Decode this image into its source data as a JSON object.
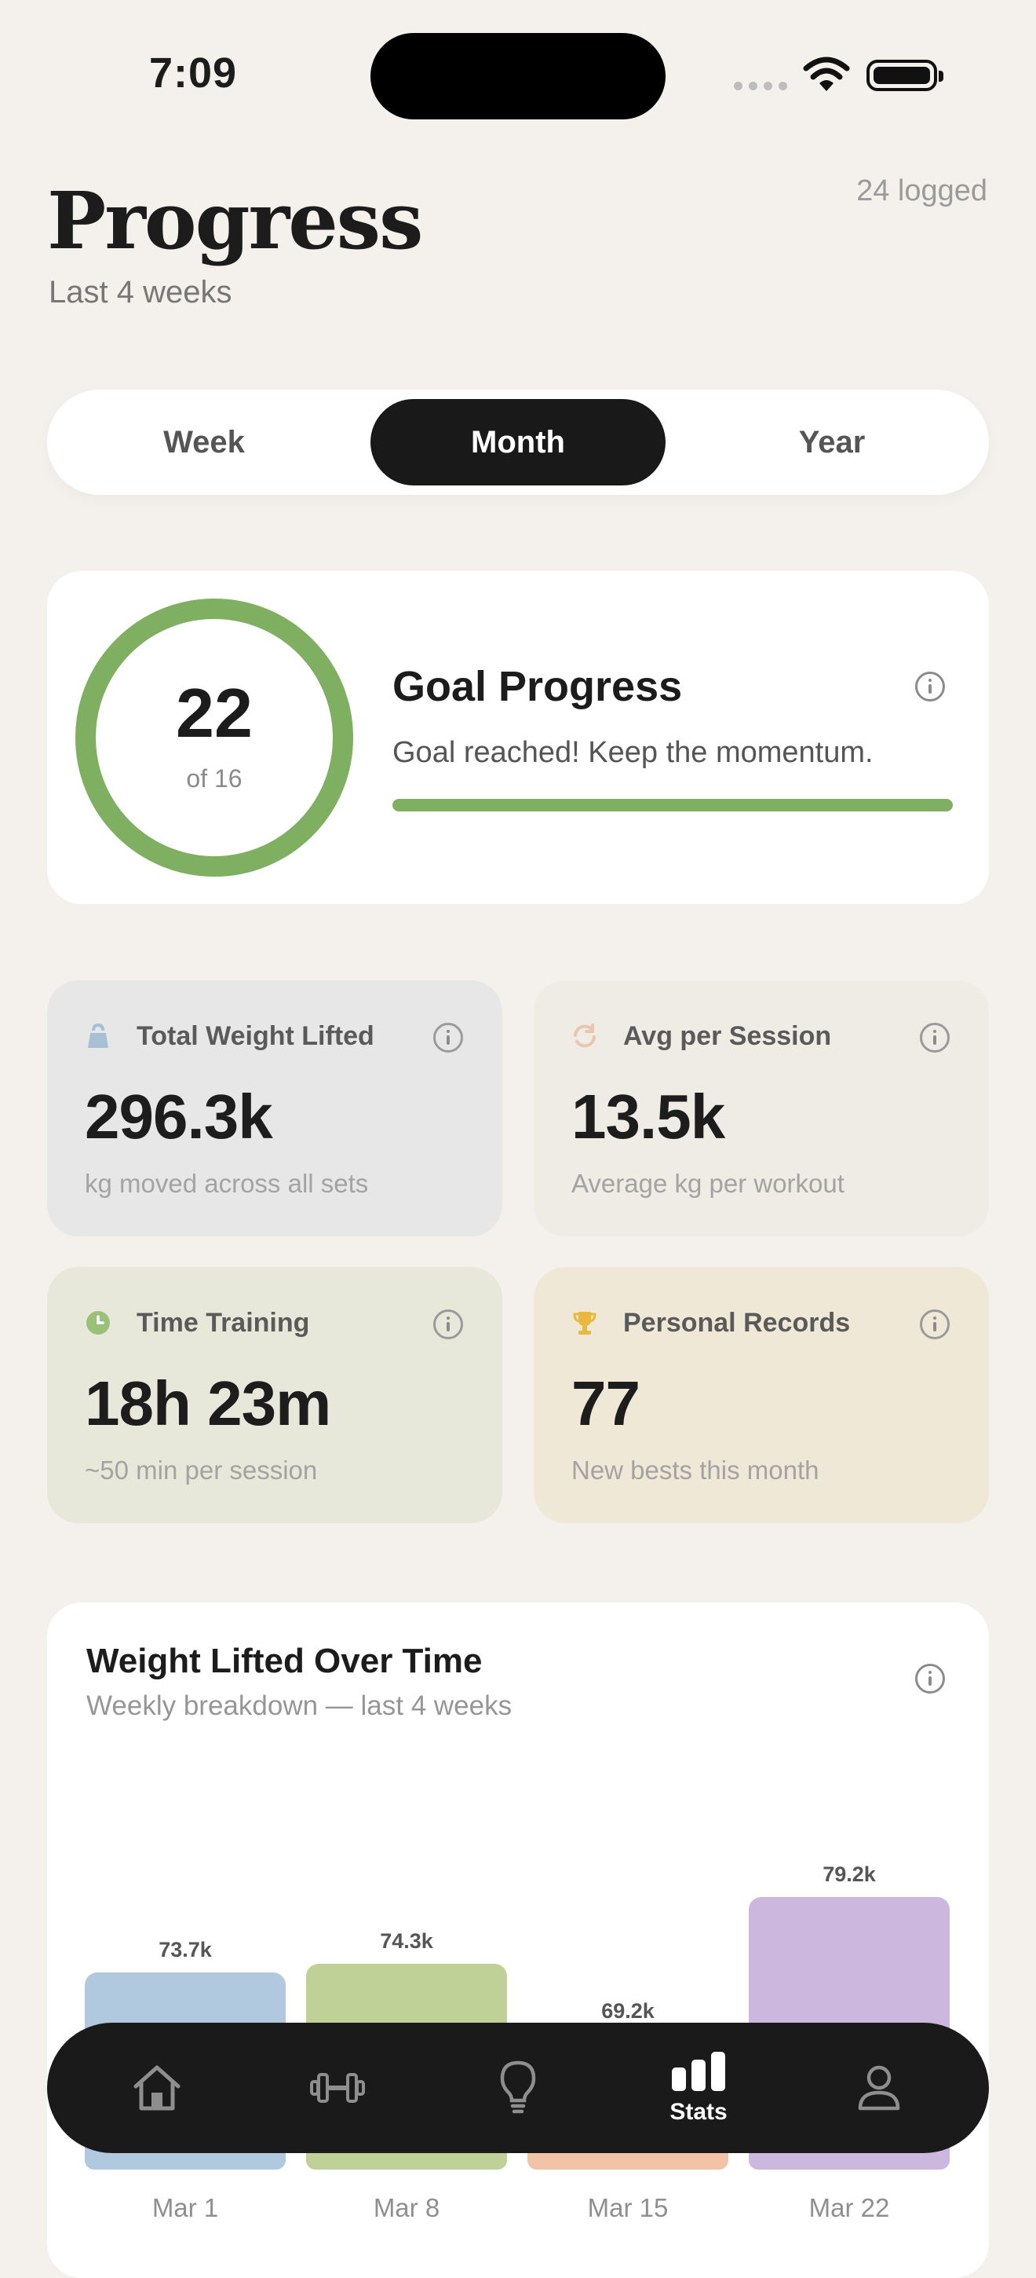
{
  "status": {
    "time": "7:09"
  },
  "header": {
    "title": "Progress",
    "subtitle": "Last 4 weeks",
    "logged": "24 logged"
  },
  "segmented": {
    "items": [
      "Week",
      "Month",
      "Year"
    ],
    "selected": "Month"
  },
  "goal": {
    "current": "22",
    "target": "of 16",
    "title": "Goal Progress",
    "message": "Goal reached! Keep the momentum.",
    "progress_fraction": 1.0,
    "color": "#7fb061"
  },
  "stats": [
    {
      "icon": "kettlebell-icon",
      "label": "Total Weight Lifted",
      "value": "296.3k",
      "note": "kg moved across all sets",
      "bg": "#e6e7e6",
      "icon_color": "#a8c0d6"
    },
    {
      "icon": "refresh-icon",
      "label": "Avg per Session",
      "value": "13.5k",
      "note": "Average kg per workout",
      "bg": "#efebe5",
      "icon_color": "#e9c6ad"
    },
    {
      "icon": "clock-icon",
      "label": "Time Training",
      "value": "18h 23m",
      "note": "~50 min per session",
      "bg": "#e8e8da",
      "icon_color": "#9bc078"
    },
    {
      "icon": "trophy-icon",
      "label": "Personal Records",
      "value": "77",
      "note": "New bests this month",
      "bg": "#f0e8d6",
      "icon_color": "#e8b93c"
    }
  ],
  "chart": {
    "title": "Weight Lifted Over Time",
    "subtitle": "Weekly breakdown — last 4 weeks"
  },
  "chart_data": {
    "type": "bar",
    "title": "Weight Lifted Over Time",
    "subtitle": "Weekly breakdown — last 4 weeks",
    "categories": [
      "Mar 1",
      "Mar 8",
      "Mar 15",
      "Mar 22"
    ],
    "values": [
      73.7,
      74.3,
      69.2,
      79.2
    ],
    "value_labels": [
      "73.7k",
      "74.3k",
      "69.2k",
      "79.2k"
    ],
    "colors": [
      "#b0c9de",
      "#bfd197",
      "#f2c3a6",
      "#ccb8de"
    ],
    "grid": false,
    "legend": "none"
  },
  "tabbar": {
    "items": [
      {
        "icon": "home-icon",
        "label": ""
      },
      {
        "icon": "dumbbell-icon",
        "label": ""
      },
      {
        "icon": "lightbulb-icon",
        "label": ""
      },
      {
        "icon": "stats-icon",
        "label": "Stats",
        "active": true
      },
      {
        "icon": "profile-icon",
        "label": ""
      }
    ]
  }
}
